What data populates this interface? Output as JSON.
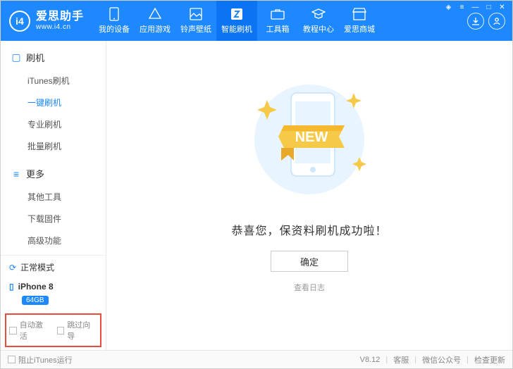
{
  "brand": {
    "name": "爱思助手",
    "url": "www.i4.cn",
    "logo_text": "i4"
  },
  "nav": [
    {
      "id": "devices",
      "label": "我的设备"
    },
    {
      "id": "apps",
      "label": "应用游戏"
    },
    {
      "id": "ring",
      "label": "铃声壁纸"
    },
    {
      "id": "flash",
      "label": "智能刷机",
      "active": true
    },
    {
      "id": "tools",
      "label": "工具箱"
    },
    {
      "id": "tutorial",
      "label": "教程中心"
    },
    {
      "id": "mall",
      "label": "爱思商城"
    }
  ],
  "sidebar": {
    "sections": [
      {
        "id": "flash",
        "title": "刷机",
        "items": [
          {
            "id": "itunes",
            "label": "iTunes刷机"
          },
          {
            "id": "oneclick",
            "label": "一键刷机",
            "active": true
          },
          {
            "id": "pro",
            "label": "专业刷机"
          },
          {
            "id": "batch",
            "label": "批量刷机"
          }
        ]
      },
      {
        "id": "more",
        "title": "更多",
        "items": [
          {
            "id": "other",
            "label": "其他工具"
          },
          {
            "id": "download",
            "label": "下载固件"
          },
          {
            "id": "advanced",
            "label": "高级功能"
          }
        ]
      }
    ],
    "status": {
      "label": "正常模式"
    },
    "device": {
      "name": "iPhone 8",
      "storage": "64GB"
    },
    "options": {
      "auto_activate": "自动激活",
      "skip_guide": "跳过向导"
    }
  },
  "main": {
    "new_tag": "NEW",
    "message": "恭喜您，保资料刷机成功啦！",
    "ok": "确定",
    "view_log": "查看日志"
  },
  "footer": {
    "block_itunes": "阻止iTunes运行",
    "version": "V8.12",
    "support": "客服",
    "wechat": "微信公众号",
    "update": "检查更新"
  }
}
